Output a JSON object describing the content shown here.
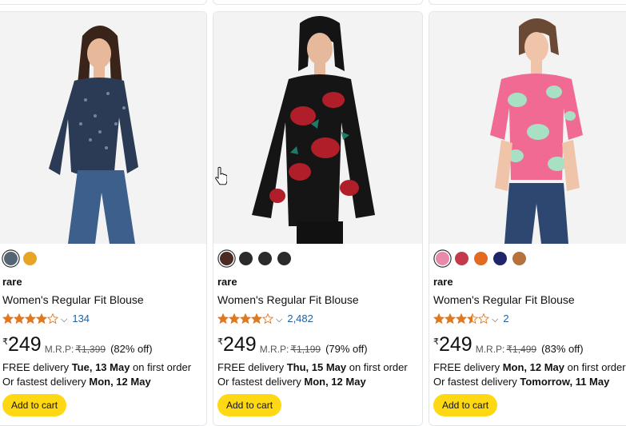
{
  "products": [
    {
      "brand": "rare",
      "title": "Women's Regular Fit Blouse",
      "rating": 4.0,
      "review_count": "134",
      "currency": "₹",
      "price": "249",
      "mrp_label": "M.R.P:",
      "mrp": "₹1,399",
      "discount": "(82% off)",
      "delivery_prefix": "FREE delivery ",
      "delivery_date": "Tue, 13 May",
      "delivery_suffix": " on first order",
      "fastest_prefix": "Or fastest delivery ",
      "fastest_date": "Mon, 12 May",
      "cart_label": "Add to cart",
      "swatches": [
        "#566573",
        "#e8a425"
      ],
      "image_colors": {
        "bg": "#f3f3f3",
        "top": "#2b3a55",
        "jeans": "#3c5f8c",
        "skin": "#e8b89a",
        "hair": "#3a241a"
      }
    },
    {
      "brand": "rare",
      "title": "Women's Regular Fit Blouse",
      "rating": 4.0,
      "review_count": "2,482",
      "currency": "₹",
      "price": "249",
      "mrp_label": "M.R.P:",
      "mrp": "₹1,199",
      "discount": "(79% off)",
      "delivery_prefix": "FREE delivery ",
      "delivery_date": "Thu, 15 May",
      "delivery_suffix": " on first order",
      "fastest_prefix": "Or fastest delivery ",
      "fastest_date": "Mon, 12 May",
      "cart_label": "Add to cart",
      "swatches": [
        "#4a2a22",
        "#2b2b2b",
        "#2b2b2b",
        "#2b2b2b"
      ],
      "image_colors": {
        "bg": "#f3f3f3",
        "top": "#151515",
        "accent": "#b01e2a",
        "pants": "#111111",
        "skin": "#e6b89c",
        "hair": "#141414"
      }
    },
    {
      "brand": "rare",
      "title": "Women's Regular Fit Blouse",
      "rating": 3.5,
      "review_count": "2",
      "currency": "₹",
      "price": "249",
      "mrp_label": "M.R.P:",
      "mrp": "₹1,499",
      "discount": "(83% off)",
      "delivery_prefix": "FREE delivery ",
      "delivery_date": "Mon, 12 May",
      "delivery_suffix": " on first order",
      "fastest_prefix": "Or fastest delivery ",
      "fastest_date": "Tomorrow, 11 May",
      "cart_label": "Add to cart",
      "swatches": [
        "#e98aa8",
        "#c43a4a",
        "#e36a1e",
        "#20246b",
        "#b5723a"
      ],
      "image_colors": {
        "bg": "#f3f3f3",
        "top": "#f06a93",
        "accent": "#a8e0c4",
        "jeans": "#2e4770",
        "skin": "#f0c4a8",
        "hair": "#6b4a35"
      }
    }
  ],
  "colors": {
    "star": "#de7921",
    "link": "#2162a1",
    "button": "#ffd814",
    "border": "#e3e6e6"
  }
}
